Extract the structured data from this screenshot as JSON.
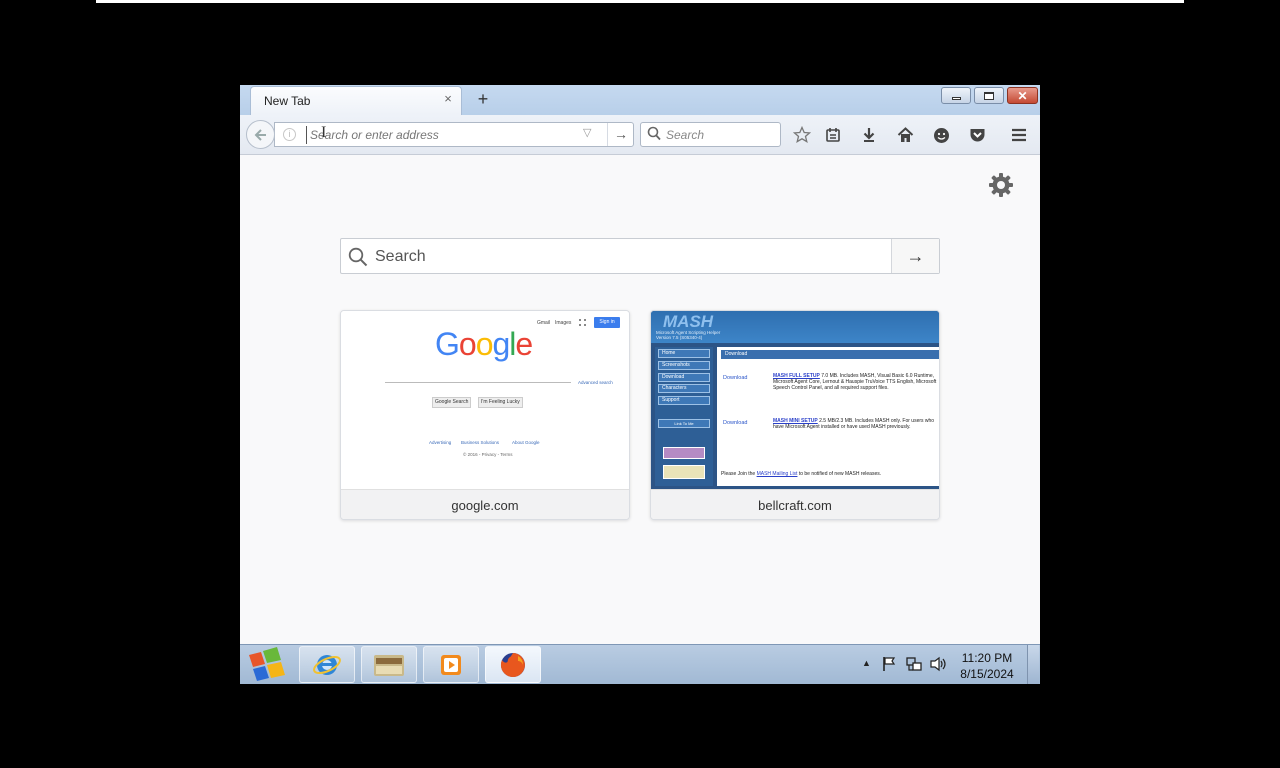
{
  "browser": {
    "tab": {
      "title": "New Tab",
      "close": "×"
    },
    "new_tab": "+",
    "urlbar": {
      "placeholder": "Search or enter address",
      "go": "→"
    },
    "searchbar": {
      "placeholder": "Search"
    },
    "window_controls": {
      "close": "✕"
    }
  },
  "newtab_page": {
    "search": {
      "placeholder": "Search",
      "go": "→"
    },
    "tiles": [
      {
        "label": "google.com",
        "thumb": {
          "logo": [
            "G",
            "o",
            "o",
            "g",
            "l",
            "e"
          ],
          "logo_colors": [
            "#4285f4",
            "#ea4335",
            "#fbbc05",
            "#4285f4",
            "#34a853",
            "#ea4335"
          ],
          "top_links": [
            "Gmail",
            "Images"
          ],
          "signin": "Sign in",
          "advanced": "Advanced search",
          "btn_search": "Google Search",
          "btn_lucky": "I'm Feeling Lucky",
          "footer_links": [
            "Advertising",
            "Business Solutions",
            "About Google"
          ],
          "footer_small": "© 2016 - Privacy - Terms"
        }
      },
      {
        "label": "bellcraft.com",
        "thumb": {
          "logo": "MASH",
          "subtitle_1": "Microsoft Agent Scripting Helper",
          "subtitle_2": "Version 7.5 (S05340-4)",
          "nav": [
            "Home",
            "Screenshots",
            "Download",
            "Characters",
            "Support"
          ],
          "nav_extra": "Link To Me",
          "section": "Download",
          "download_1": "Download",
          "item_1_title": "MASH FULL SETUP",
          "item_1_text": "7.0 MB. Includes MASH, Visual Basic 6.0 Runtime, Microsoft Agent Core, Lernout & Hauspie TruVoice TTS English, Microsoft Speech Control Panel, and all required support files.",
          "download_2": "Download",
          "item_2_title": "MASH MINI SETUP",
          "item_2_text": "2.5 MB/2.3 MB. Includes MASH only. For users who have Microsoft Agent installed or have used MASH previously.",
          "footer_text_1": "Please Join the",
          "footer_link": "MASH Mailing List",
          "footer_text_2": "to be notified of new MASH releases."
        }
      }
    ]
  },
  "taskbar": {
    "tray_arrow": "▲",
    "clock_time": "11:20 PM",
    "clock_date": "8/15/2024"
  },
  "colors": {
    "accent": "#0a84ff",
    "titlebar": "#c5d9f0",
    "taskbar": "#a1b9d4",
    "close_button": "#c44a33"
  }
}
